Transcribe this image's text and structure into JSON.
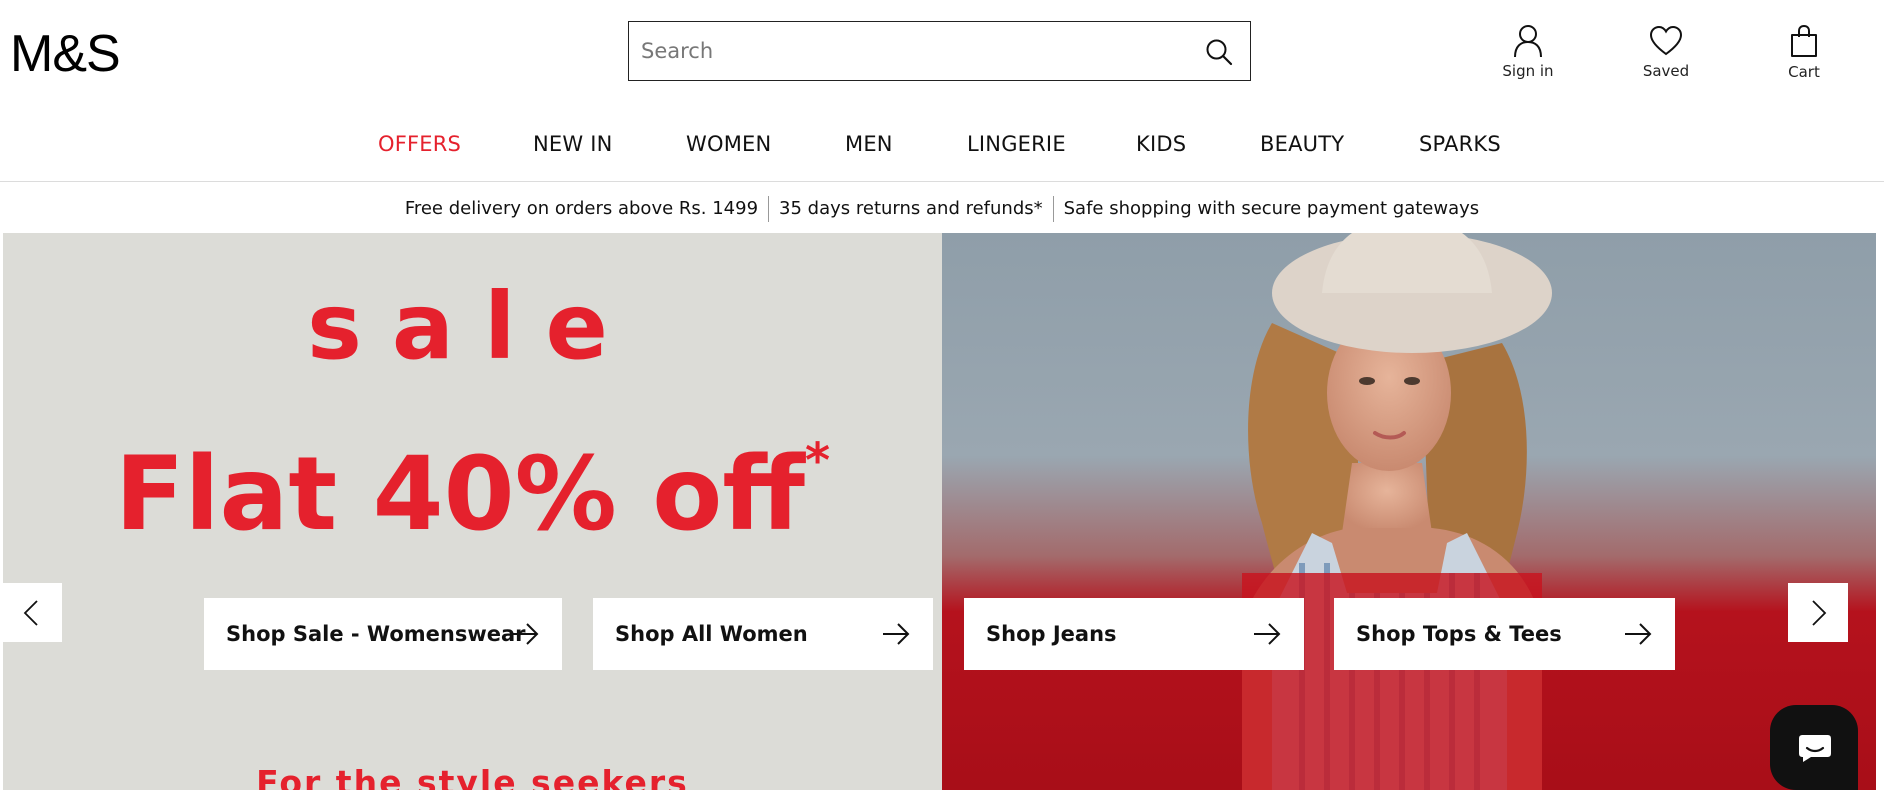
{
  "header": {
    "logo": "M&S",
    "search": {
      "placeholder": "Search",
      "value": ""
    },
    "icons": [
      {
        "name": "user-icon",
        "label": "Sign in"
      },
      {
        "name": "heart-icon",
        "label": "Saved"
      },
      {
        "name": "bag-icon",
        "label": "Cart"
      }
    ]
  },
  "nav": {
    "items": [
      "OFFERS",
      "NEW IN",
      "WOMEN",
      "MEN",
      "LINGERIE",
      "KIDS",
      "BEAUTY",
      "SPARKS"
    ],
    "active_color": "#e5212d"
  },
  "usp": [
    "Free delivery on orders above Rs. 1499",
    "35 days returns and refunds*",
    "Safe shopping with secure payment gateways"
  ],
  "hero": {
    "sale_word": "sale",
    "headline": "Flat 40% off",
    "headline_mark": "*",
    "subline": "For the style seekers",
    "ctas": [
      "Shop Sale - Womenswear",
      "Shop All Women",
      "Shop Jeans",
      "Shop Tops & Tees"
    ],
    "accent_color": "#e5212d"
  }
}
